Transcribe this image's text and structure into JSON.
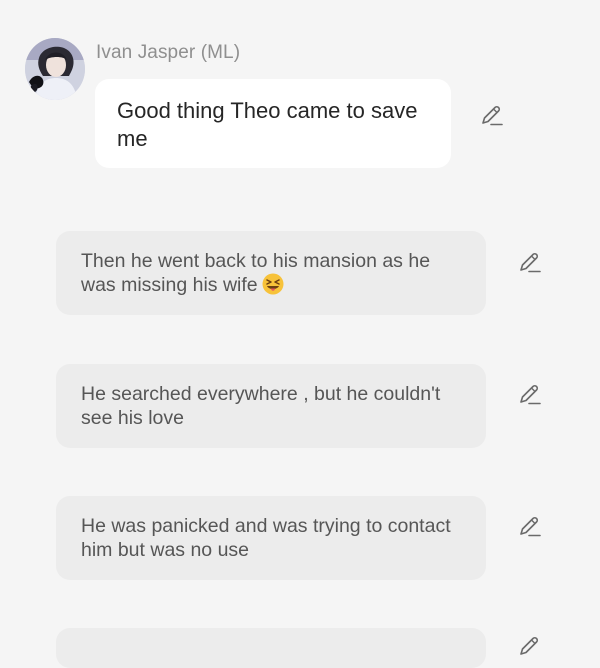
{
  "chat": {
    "sender": {
      "name": "Ivan Jasper (ML)",
      "avatar_icon": "profile-avatar"
    },
    "messages": [
      {
        "text": "Good thing Theo came to save me",
        "style": "character-bubble",
        "bubble_color": "#ffffff"
      },
      {
        "text": "Then he went back to his mansion as he was missing his wife",
        "emoji": "squinting-face-with-tongue",
        "style": "narration-bubble",
        "bubble_color": "#ececec"
      },
      {
        "text": "He searched everywhere , but he couldn't see his love",
        "style": "narration-bubble",
        "bubble_color": "#ececec"
      },
      {
        "text": "He was panicked and was trying to contact him but was no use",
        "style": "narration-bubble",
        "bubble_color": "#ececec"
      }
    ],
    "edit_icon": "pencil-icon"
  },
  "colors": {
    "background": "#f5f5f5",
    "name_text": "#8f8f8f",
    "narration_text": "#565656",
    "icon": "#6a6a6a"
  }
}
